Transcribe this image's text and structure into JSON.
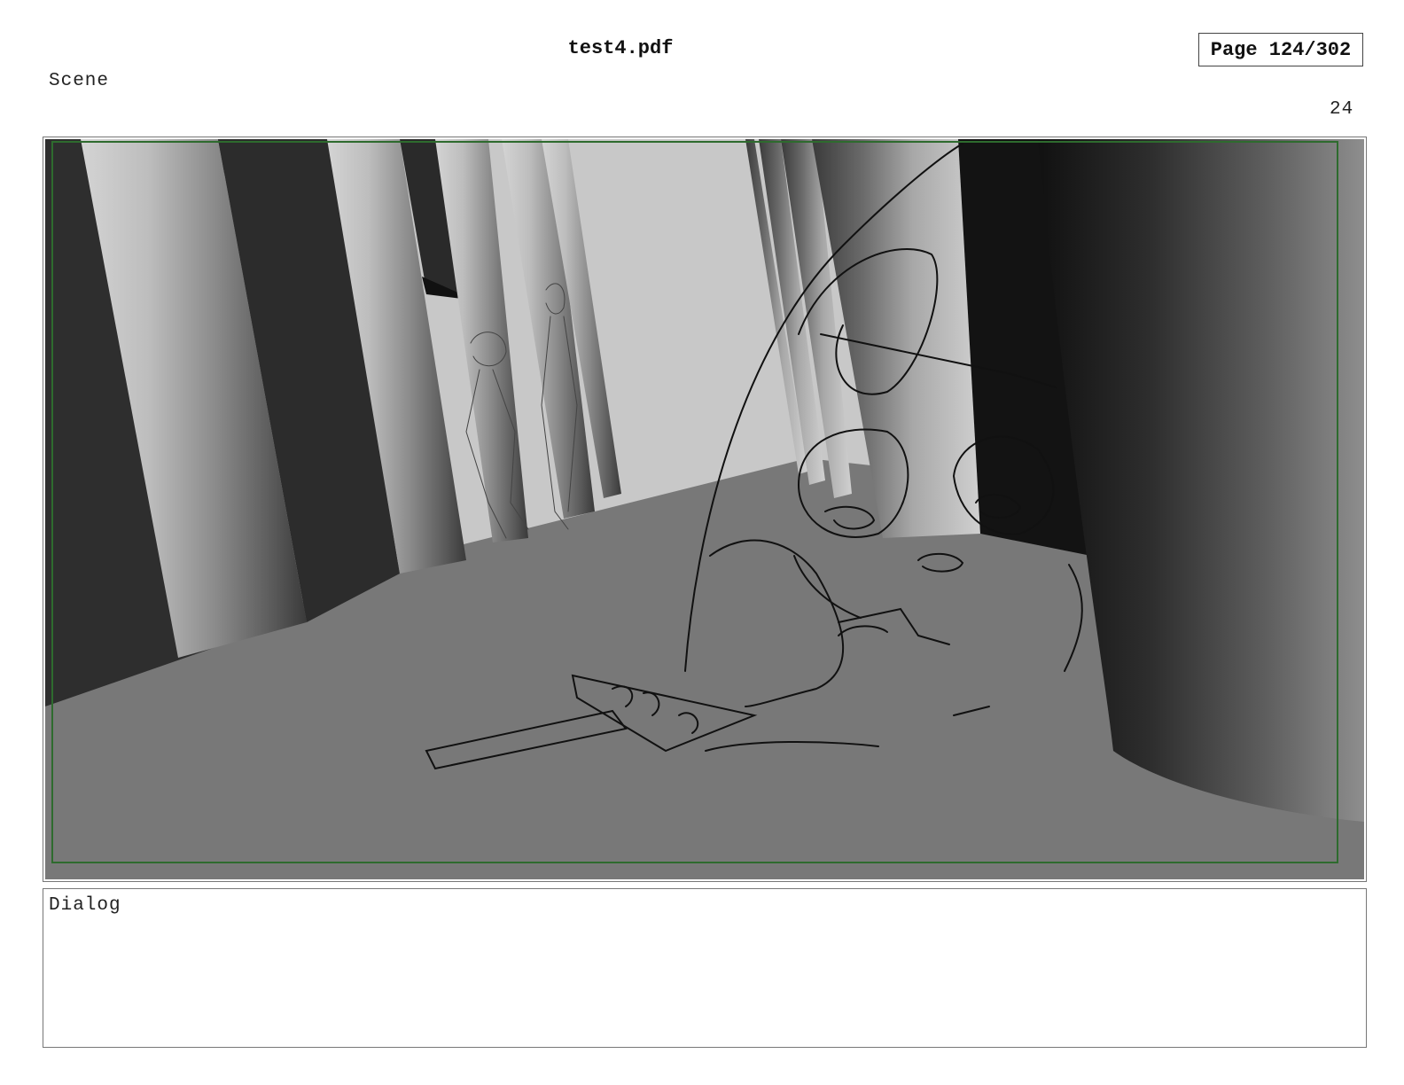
{
  "document": {
    "title": "test4.pdf",
    "page_indicator": "Page 124/302"
  },
  "panel": {
    "scene_label": "Scene",
    "panel_number": "24",
    "image_description_icon": "storyboard-sketch-image"
  },
  "dialog": {
    "label": "Dialog",
    "text": ""
  },
  "colors": {
    "safe_frame": "#2e6b2e",
    "floor": "#777777",
    "backdrop": "#c8c8c8"
  }
}
